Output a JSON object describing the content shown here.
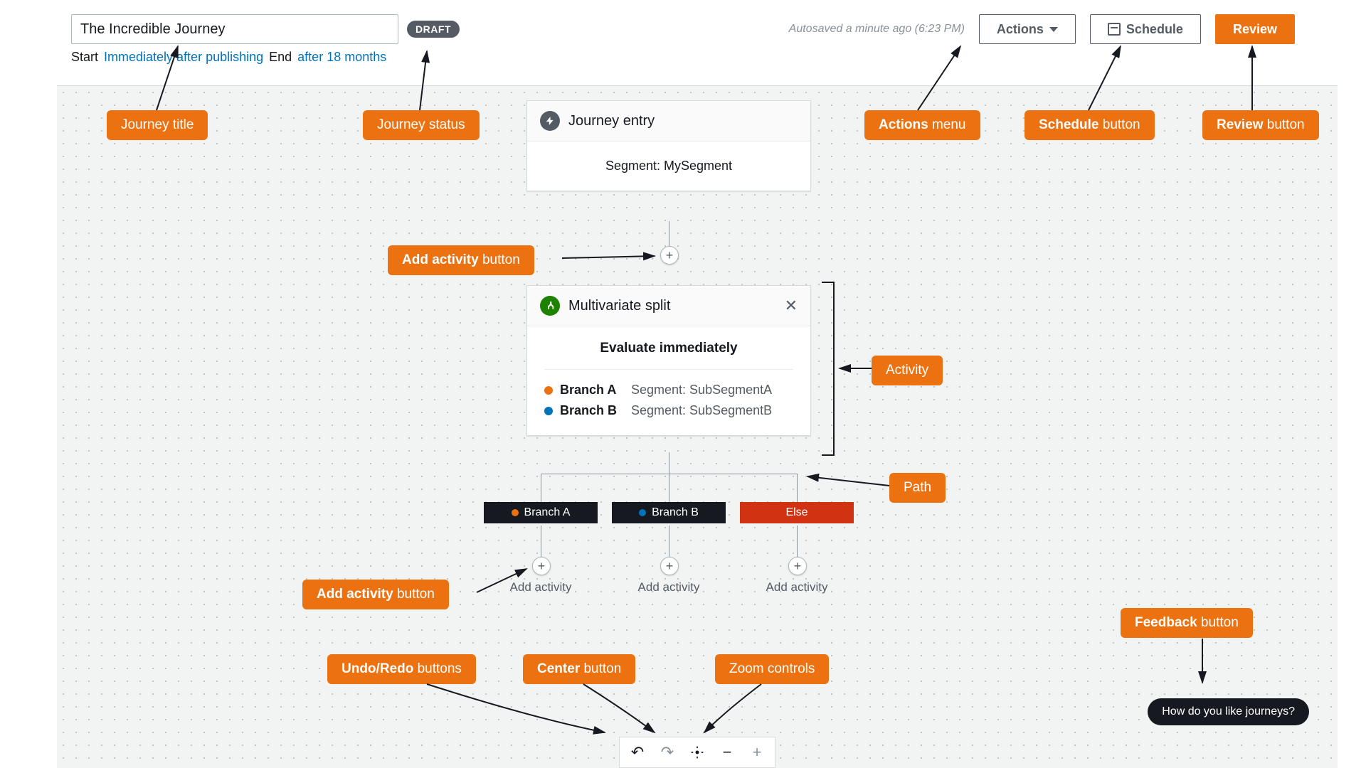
{
  "header": {
    "title": "The Incredible Journey",
    "status": "DRAFT",
    "start_label": "Start",
    "start_value": "Immediately after publishing",
    "end_label": "End",
    "end_value": "after 18 months",
    "autosave": "Autosaved a minute ago (6:23 PM)",
    "actions_label": "Actions",
    "schedule_label": "Schedule",
    "review_label": "Review"
  },
  "entry": {
    "title": "Journey entry",
    "segment": "Segment: MySegment"
  },
  "split": {
    "title": "Multivariate split",
    "evaluate": "Evaluate immediately",
    "branches": [
      {
        "name": "Branch A",
        "segment": "Segment: SubSegmentA"
      },
      {
        "name": "Branch B",
        "segment": "Segment: SubSegmentB"
      }
    ]
  },
  "chips": {
    "a": "Branch A",
    "b": "Branch B",
    "else": "Else"
  },
  "add_label": "Add activity",
  "feedback": "How do you like journeys?",
  "callouts": {
    "journey_title": "Journey title",
    "journey_status": "Journey status",
    "actions_menu": {
      "bold": "Actions",
      "rest": " menu"
    },
    "schedule_button": {
      "bold": "Schedule",
      "rest": " button"
    },
    "review_button": {
      "bold": "Review",
      "rest": " button"
    },
    "add_activity_button": {
      "bold": "Add activity",
      "rest": " button"
    },
    "activity": "Activity",
    "path": "Path",
    "feedback_button": {
      "bold": "Feedback",
      "rest": " button"
    },
    "undo_redo": {
      "bold": "Undo/Redo",
      "rest": " buttons"
    },
    "center_button": {
      "bold": "Center",
      "rest": " button"
    },
    "zoom_controls": "Zoom controls"
  }
}
